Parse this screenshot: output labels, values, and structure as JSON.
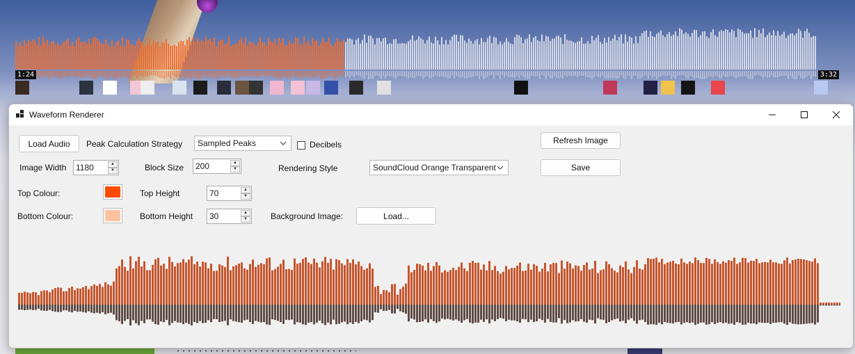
{
  "window": {
    "title": "Waveform Renderer"
  },
  "player": {
    "time_start": "1:24",
    "time_end": "3:32",
    "progress": 0.4,
    "played_color": "#f26b2a",
    "unplayed_color": "#e9e9ee"
  },
  "controls": {
    "load_audio": "Load Audio",
    "peak_strategy_label": "Peak Calculation Strategy",
    "peak_strategy_value": "Sampled Peaks",
    "decibels_label": "Decibels",
    "decibels_checked": false,
    "refresh_image": "Refresh Image",
    "image_width_label": "Image Width",
    "image_width_value": "1180",
    "block_size_label": "Block Size",
    "block_size_value": "200",
    "rendering_style_label": "Rendering Style",
    "rendering_style_value": "SoundCloud Orange Transparent",
    "save": "Save",
    "top_colour_label": "Top Colour:",
    "top_colour": "#ff4b00",
    "top_height_label": "Top Height",
    "top_height_value": "70",
    "bottom_colour_label": "Bottom Colour:",
    "bottom_colour": "#ffc2a0",
    "bottom_height_label": "Bottom Height",
    "bottom_height_value": "30",
    "background_image_label": "Background Image:",
    "load_button": "Load..."
  },
  "preview": {
    "top_color": "#c5552d",
    "bottom_color": "#5e4a44"
  },
  "thumbnails": [
    "#3a2b22",
    "#2b3340",
    "#ffffff",
    "#f3c6d8",
    "#eeeeee",
    "#d9e3ee",
    "#1b1b1b",
    "#2a2d3b",
    "#6b5440",
    "#333333",
    "#f0b8d0",
    "#f5c1d6",
    "#c7b8e6",
    "#3550a8",
    "#2a2a2a",
    "#e0e0e0",
    "#111111",
    "#c0395a",
    "#222244",
    "#f2c14e",
    "#151515",
    "#e8464a",
    "#b9c8ef"
  ],
  "icons": {
    "app": "app-grid-icon",
    "minimize": "minimize-icon",
    "maximize": "maximize-icon",
    "close": "close-icon",
    "chevron": "chevron-down-icon"
  }
}
